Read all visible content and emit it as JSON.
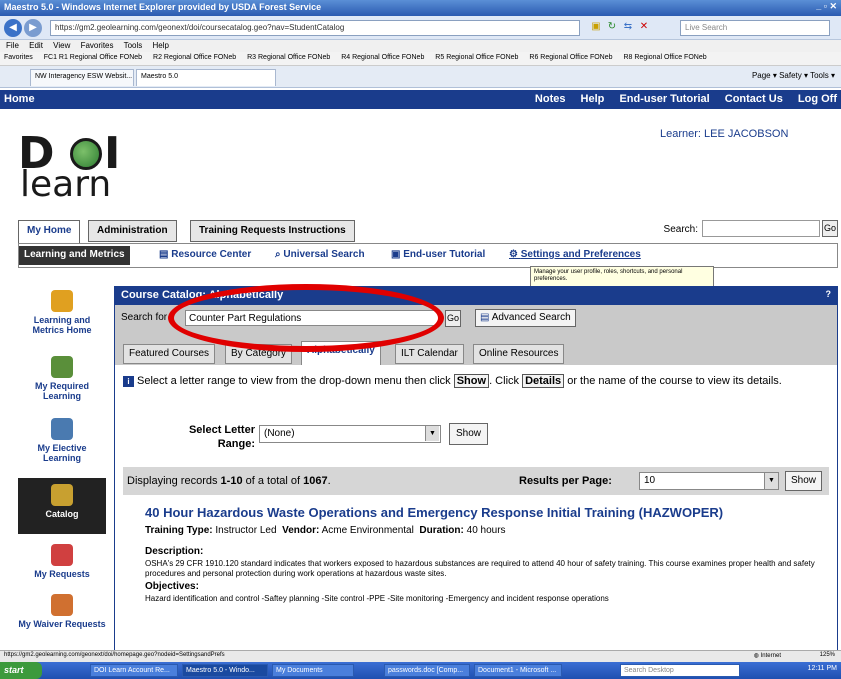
{
  "browser": {
    "title": "Maestro 5.0 - Windows Internet Explorer provided by USDA Forest Service",
    "address": "https://gm2.geolearning.com/geonext/doi/coursecatalog.geo?nav=StudentCatalog",
    "search_placeholder": "Live Search",
    "menu": [
      "File",
      "Edit",
      "View",
      "Favorites",
      "Tools",
      "Help"
    ],
    "favorites_label": "Favorites",
    "favorites": [
      "FC1 R1 Regional Office FONeb",
      "R2 Regional Office FONeb",
      "R3 Regional Office FONeb",
      "R4 Regional Office FONeb",
      "R5 Regional Office FONeb",
      "R6 Regional Office FONeb",
      "R8 Regional Office FONeb"
    ],
    "tabs": [
      "NW Interagency ESW Websit...",
      "Maestro 5.0"
    ],
    "command_bar": "Page ▾   Safety ▾   Tools ▾"
  },
  "topnav": {
    "home": "Home",
    "links": [
      "Notes",
      "Help",
      "End-user Tutorial",
      "Contact Us",
      "Log Off"
    ]
  },
  "logo": {
    "line1": "D",
    "line1b": "I",
    "line2": "learn"
  },
  "learner": {
    "label": "Learner:",
    "name": "LEE JACOBSON"
  },
  "site_tabs": [
    "My Home",
    "Administration",
    "Training Requests Instructions"
  ],
  "site_search": {
    "label": "Search:",
    "go": "Go"
  },
  "subnav": [
    "Learning and Metrics",
    "Resource Center",
    "Universal Search",
    "End-user Tutorial",
    "Settings and Preferences"
  ],
  "tooltip": "Manage your user profile, roles, shortcuts, and personal preferences.",
  "sidebar": [
    {
      "label": "Learning and Metrics Home"
    },
    {
      "label": "My Required Learning"
    },
    {
      "label": "My Elective Learning"
    },
    {
      "label": "Catalog"
    },
    {
      "label": "My Requests"
    },
    {
      "label": "My Waiver Requests"
    }
  ],
  "panel": {
    "title": "Course Catalog: Alphabetically",
    "help": "?",
    "search_label": "Search for",
    "search_value": "Counter Part Regulations",
    "go": "Go",
    "advanced": "Advanced Search",
    "tabs": [
      "Featured Courses",
      "By Category",
      "Alphabetically",
      "ILT Calendar",
      "Online Resources"
    ],
    "instr_a": "Select a letter range to view from the drop-down menu then click",
    "instr_show": "Show",
    "instr_b": ". Click",
    "instr_details": "Details",
    "instr_c": "or the name of the course to view its details.",
    "letter_label": "Select Letter Range:",
    "letter_value": "(None)",
    "show": "Show",
    "records_a": "Displaying records",
    "records_range": "1-10",
    "records_b": "of a total of",
    "records_total": "1067",
    "records_c": ".",
    "rpp_label": "Results per Page:",
    "rpp_value": "10"
  },
  "course": {
    "title": "40 Hour Hazardous Waste Operations and Emergency Response Initial Training (HAZWOPER)",
    "type_label": "Training Type:",
    "type": "Instructor Led",
    "vendor_label": "Vendor:",
    "vendor": "Acme Environmental",
    "duration_label": "Duration:",
    "duration": "40 hours",
    "desc_label": "Description:",
    "desc": "OSHA's 29 CFR 1910.120 standard indicates that workers exposed to hazardous substances are required to attend 40 hour of safety training. This course examines proper health and safety procedures and personal protection during work operations at hazardous waste sites.",
    "obj_label": "Objectives:",
    "obj": "Hazard identification and control -Saftey planning -Site control -PPE -Site monitoring -Emergency and incident response operations"
  },
  "statusbar": {
    "url": "https://gm2.geolearning.com/geonext/doi/homepage.geo?nodeid=SettingsandPrefs",
    "zone": "Internet",
    "zoom": "125%"
  },
  "taskbar": {
    "start": "start",
    "items": [
      "DOI Learn Account Re...",
      "Maestro 5.0 - Windo...",
      "My Documents",
      "passwords.doc [Comp...",
      "Document1 - Microsoft ...",
      "Search Desktop"
    ],
    "clock": "12:11 PM"
  },
  "colors": {
    "brand": "#1a3c8c",
    "highlight": "#e00000"
  }
}
